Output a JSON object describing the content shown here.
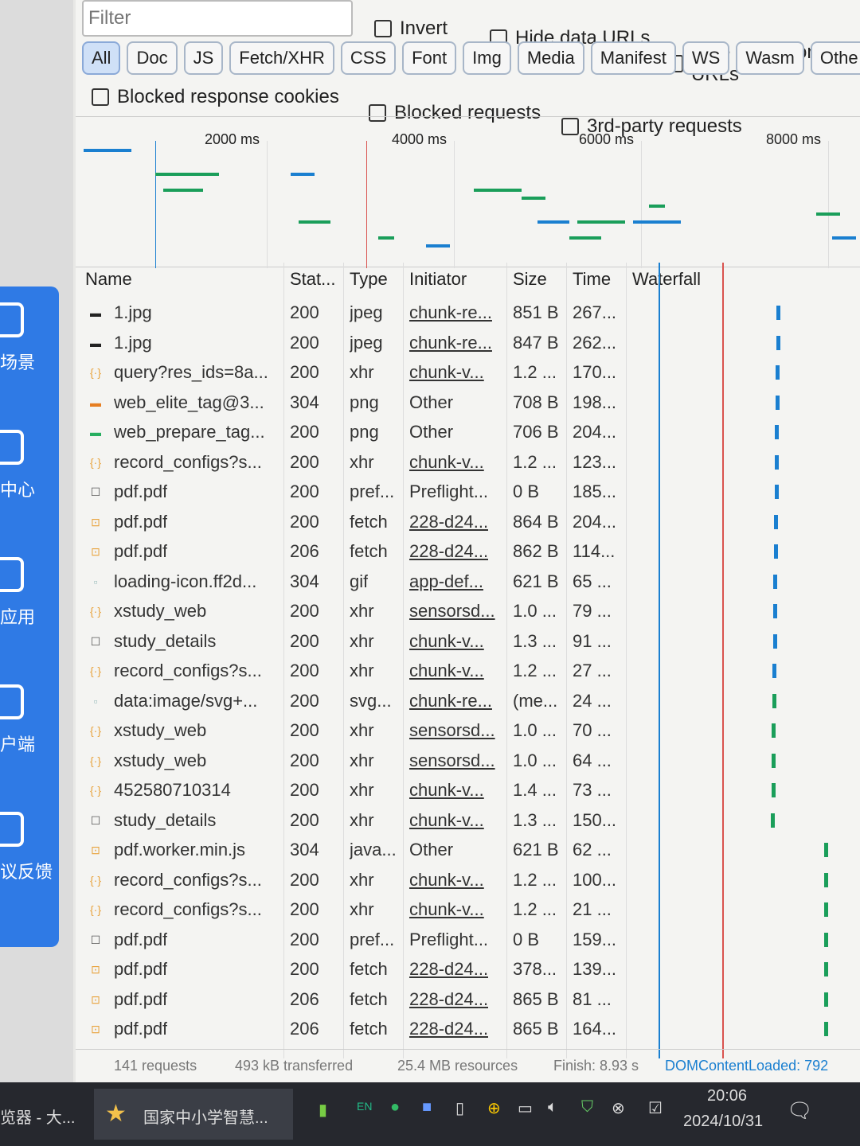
{
  "sidebar": {
    "items": [
      "场景",
      "中心",
      "应用",
      "户端",
      "议反馈"
    ]
  },
  "filter": {
    "placeholder": "Filter",
    "invert": "Invert",
    "hide_data_urls": "Hide data URLs",
    "hide_extension_urls": "Hide extension URLs",
    "blocked_cookies": "Blocked response cookies",
    "blocked_requests": "Blocked requests",
    "third_party": "3rd-party requests"
  },
  "types": [
    "All",
    "Doc",
    "JS",
    "Fetch/XHR",
    "CSS",
    "Font",
    "Img",
    "Media",
    "Manifest",
    "WS",
    "Wasm",
    "Othe"
  ],
  "overview": {
    "ticks": [
      "2000 ms",
      "4000 ms",
      "6000 ms",
      "8000 ms"
    ]
  },
  "columns": [
    "Name",
    "Stat...",
    "Type",
    "Initiator",
    "Size",
    "Time",
    "Waterfall"
  ],
  "rows": [
    [
      "1.jpg",
      "200",
      "jpeg",
      "chunk-re...",
      "851 B",
      "267...",
      "img-dark"
    ],
    [
      "1.jpg",
      "200",
      "jpeg",
      "chunk-re...",
      "847 B",
      "262...",
      "img-dark"
    ],
    [
      "query?res_ids=8a...",
      "200",
      "xhr",
      "chunk-v...",
      "1.2 ...",
      "170...",
      "xhr"
    ],
    [
      "web_elite_tag@3...",
      "304",
      "png",
      "Other",
      "708 B",
      "198...",
      "img-orange"
    ],
    [
      "web_prepare_tag...",
      "200",
      "png",
      "Other",
      "706 B",
      "204...",
      "img-green"
    ],
    [
      "record_configs?s...",
      "200",
      "xhr",
      "chunk-v...",
      "1.2 ...",
      "123...",
      "xhr"
    ],
    [
      "pdf.pdf",
      "200",
      "pref...",
      "Preflight...",
      "0 B",
      "185...",
      "doc"
    ],
    [
      "pdf.pdf",
      "200",
      "fetch",
      "228-d24...",
      "864 B",
      "204...",
      "fetch"
    ],
    [
      "pdf.pdf",
      "206",
      "fetch",
      "228-d24...",
      "862 B",
      "114...",
      "fetch"
    ],
    [
      "loading-icon.ff2d...",
      "304",
      "gif",
      "app-def...",
      "621 B",
      "65 ...",
      "img-light"
    ],
    [
      "xstudy_web",
      "200",
      "xhr",
      "sensorsd...",
      "1.0 ...",
      "79 ...",
      "xhr"
    ],
    [
      "study_details",
      "200",
      "xhr",
      "chunk-v...",
      "1.3 ...",
      "91 ...",
      "doc"
    ],
    [
      "record_configs?s...",
      "200",
      "xhr",
      "chunk-v...",
      "1.2 ...",
      "27 ...",
      "xhr"
    ],
    [
      "data:image/svg+...",
      "200",
      "svg...",
      "chunk-re...",
      "(me...",
      "24 ...",
      "img-light"
    ],
    [
      "xstudy_web",
      "200",
      "xhr",
      "sensorsd...",
      "1.0 ...",
      "70 ...",
      "xhr"
    ],
    [
      "xstudy_web",
      "200",
      "xhr",
      "sensorsd...",
      "1.0 ...",
      "64 ...",
      "xhr"
    ],
    [
      "452580710314",
      "200",
      "xhr",
      "chunk-v...",
      "1.4 ...",
      "73 ...",
      "xhr"
    ],
    [
      "study_details",
      "200",
      "xhr",
      "chunk-v...",
      "1.3 ...",
      "150...",
      "doc"
    ],
    [
      "pdf.worker.min.js",
      "304",
      "java...",
      "Other",
      "621 B",
      "62 ...",
      "fetch"
    ],
    [
      "record_configs?s...",
      "200",
      "xhr",
      "chunk-v...",
      "1.2 ...",
      "100...",
      "xhr"
    ],
    [
      "record_configs?s...",
      "200",
      "xhr",
      "chunk-v...",
      "1.2 ...",
      "21 ...",
      "xhr"
    ],
    [
      "pdf.pdf",
      "200",
      "pref...",
      "Preflight...",
      "0 B",
      "159...",
      "doc"
    ],
    [
      "pdf.pdf",
      "200",
      "fetch",
      "228-d24...",
      "378...",
      "139...",
      "fetch"
    ],
    [
      "pdf.pdf",
      "206",
      "fetch",
      "228-d24...",
      "865 B",
      "81 ...",
      "fetch"
    ],
    [
      "pdf.pdf",
      "206",
      "fetch",
      "228-d24...",
      "865 B",
      "164...",
      "fetch"
    ]
  ],
  "status": {
    "requests": "141 requests",
    "transferred": "493 kB transferred",
    "resources": "25.4 MB resources",
    "finish": "Finish: 8.93 s",
    "dcl": "DOMContentLoaded: 792"
  },
  "taskbar": {
    "app1": "览器 - 大...",
    "app2": "国家中小学智慧...",
    "time": "20:06",
    "date": "2024/10/31"
  },
  "colors": {
    "accent": "#2f7ae5",
    "dcl_line": "#1a7fd0",
    "load_line": "#d9534f",
    "bar_green": "#1a9e5a"
  }
}
